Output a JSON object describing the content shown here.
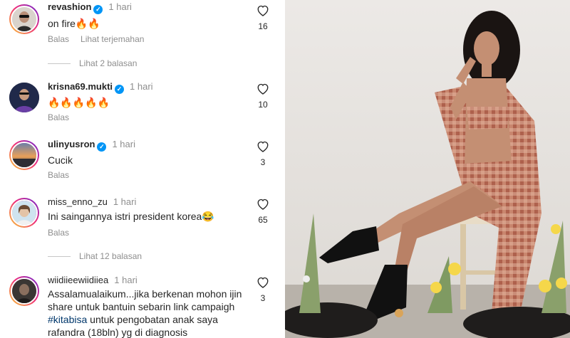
{
  "comments": [
    {
      "username": "revashion",
      "verified": true,
      "time": "1 hari",
      "text": "on fire🔥🔥",
      "likes": "16",
      "actions": [
        "Balas",
        "Lihat terjemahan"
      ]
    },
    {
      "username": "krisna69.mukti",
      "verified": true,
      "time": "1 hari",
      "text": "🔥🔥🔥🔥🔥",
      "likes": "10",
      "actions": [
        "Balas"
      ]
    },
    {
      "username": "ulinyusron",
      "verified": true,
      "time": "1 hari",
      "text": "Cucik",
      "likes": "3",
      "actions": [
        "Balas"
      ]
    },
    {
      "username": "miss_enno_zu",
      "verified": false,
      "time": "1 hari",
      "text": "Ini saingannya istri president korea😂",
      "likes": "65",
      "actions": [
        "Balas"
      ]
    },
    {
      "username": "wiidiieewiidiiea",
      "verified": false,
      "time": "1 hari",
      "text_before": "Assalamualaikum...jika berkenan mohon ijin share untuk bantuin sebarin link campaigh ",
      "hashtag": "#kitabisa",
      "text_after": " untuk pengobatan anak saya rafandra (18bln) yg di diagnosis",
      "likes": "3",
      "actions": []
    }
  ],
  "view_replies": [
    "Lihat 2 balasan",
    "Lihat 12 balasan"
  ],
  "icons": {
    "like": "heart-outline-icon",
    "verified": "verified-badge-icon"
  },
  "colors": {
    "link": "#00376b",
    "muted": "#8e8e8e",
    "verified": "#0095f6"
  }
}
